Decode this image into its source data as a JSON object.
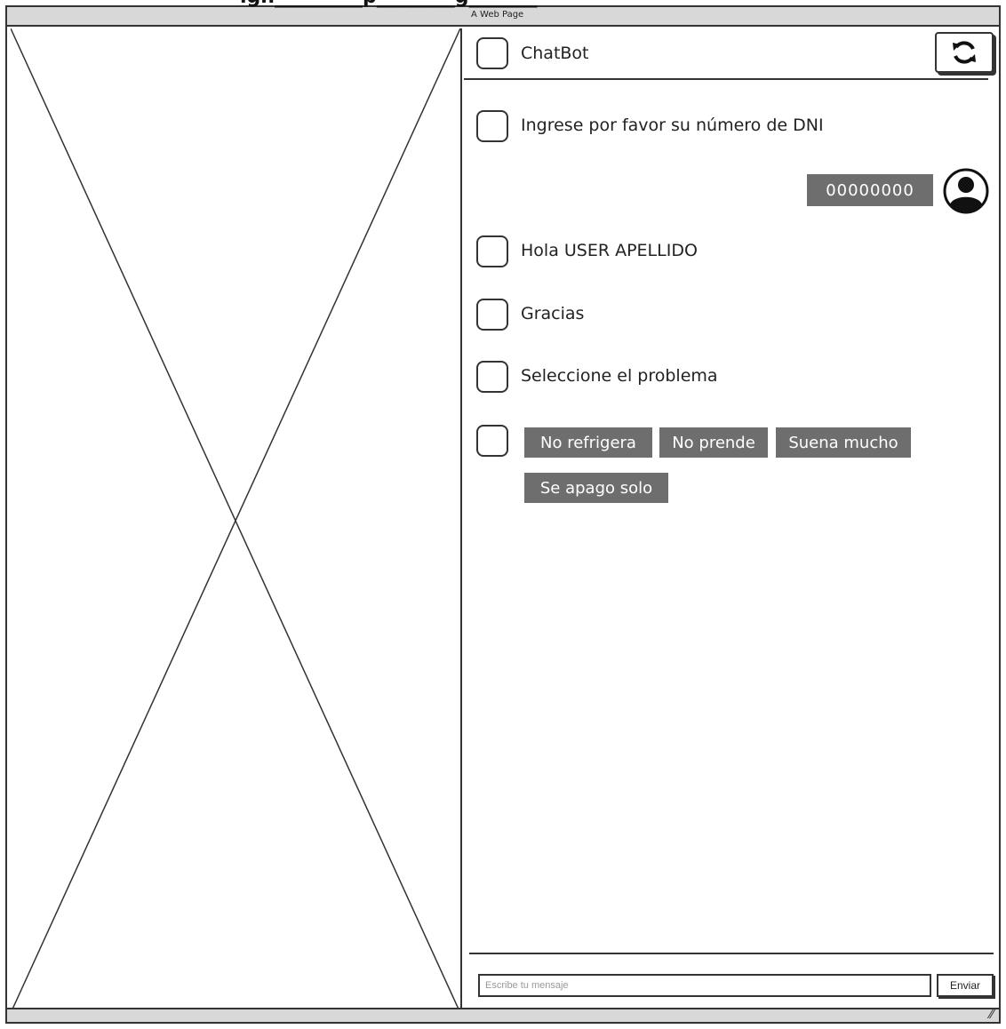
{
  "page": {
    "heading": "ign_________p________g_______",
    "window_title": "A Web Page"
  },
  "placeholder": {
    "icon": "image-placeholder-x"
  },
  "header": {
    "title": "ChatBot",
    "refresh_icon": "refresh-icon"
  },
  "messages": [
    {
      "text": "Ingrese por favor su número de DNI"
    },
    {
      "text": "Hola USER APELLIDO"
    },
    {
      "text": "Gracias"
    },
    {
      "text": "Seleccione el problema"
    }
  ],
  "user_reply": {
    "value": "00000000",
    "avatar_icon": "user-avatar-icon"
  },
  "options": [
    "No refrigera",
    "No prende",
    "Suena mucho",
    "Se apago solo"
  ],
  "composer": {
    "placeholder": "Escribe tu mensaje",
    "value": "",
    "send_label": "Enviar"
  },
  "colors": {
    "bubble": "#6e6e6e",
    "border": "#333333",
    "chrome": "#d8d8d8"
  }
}
